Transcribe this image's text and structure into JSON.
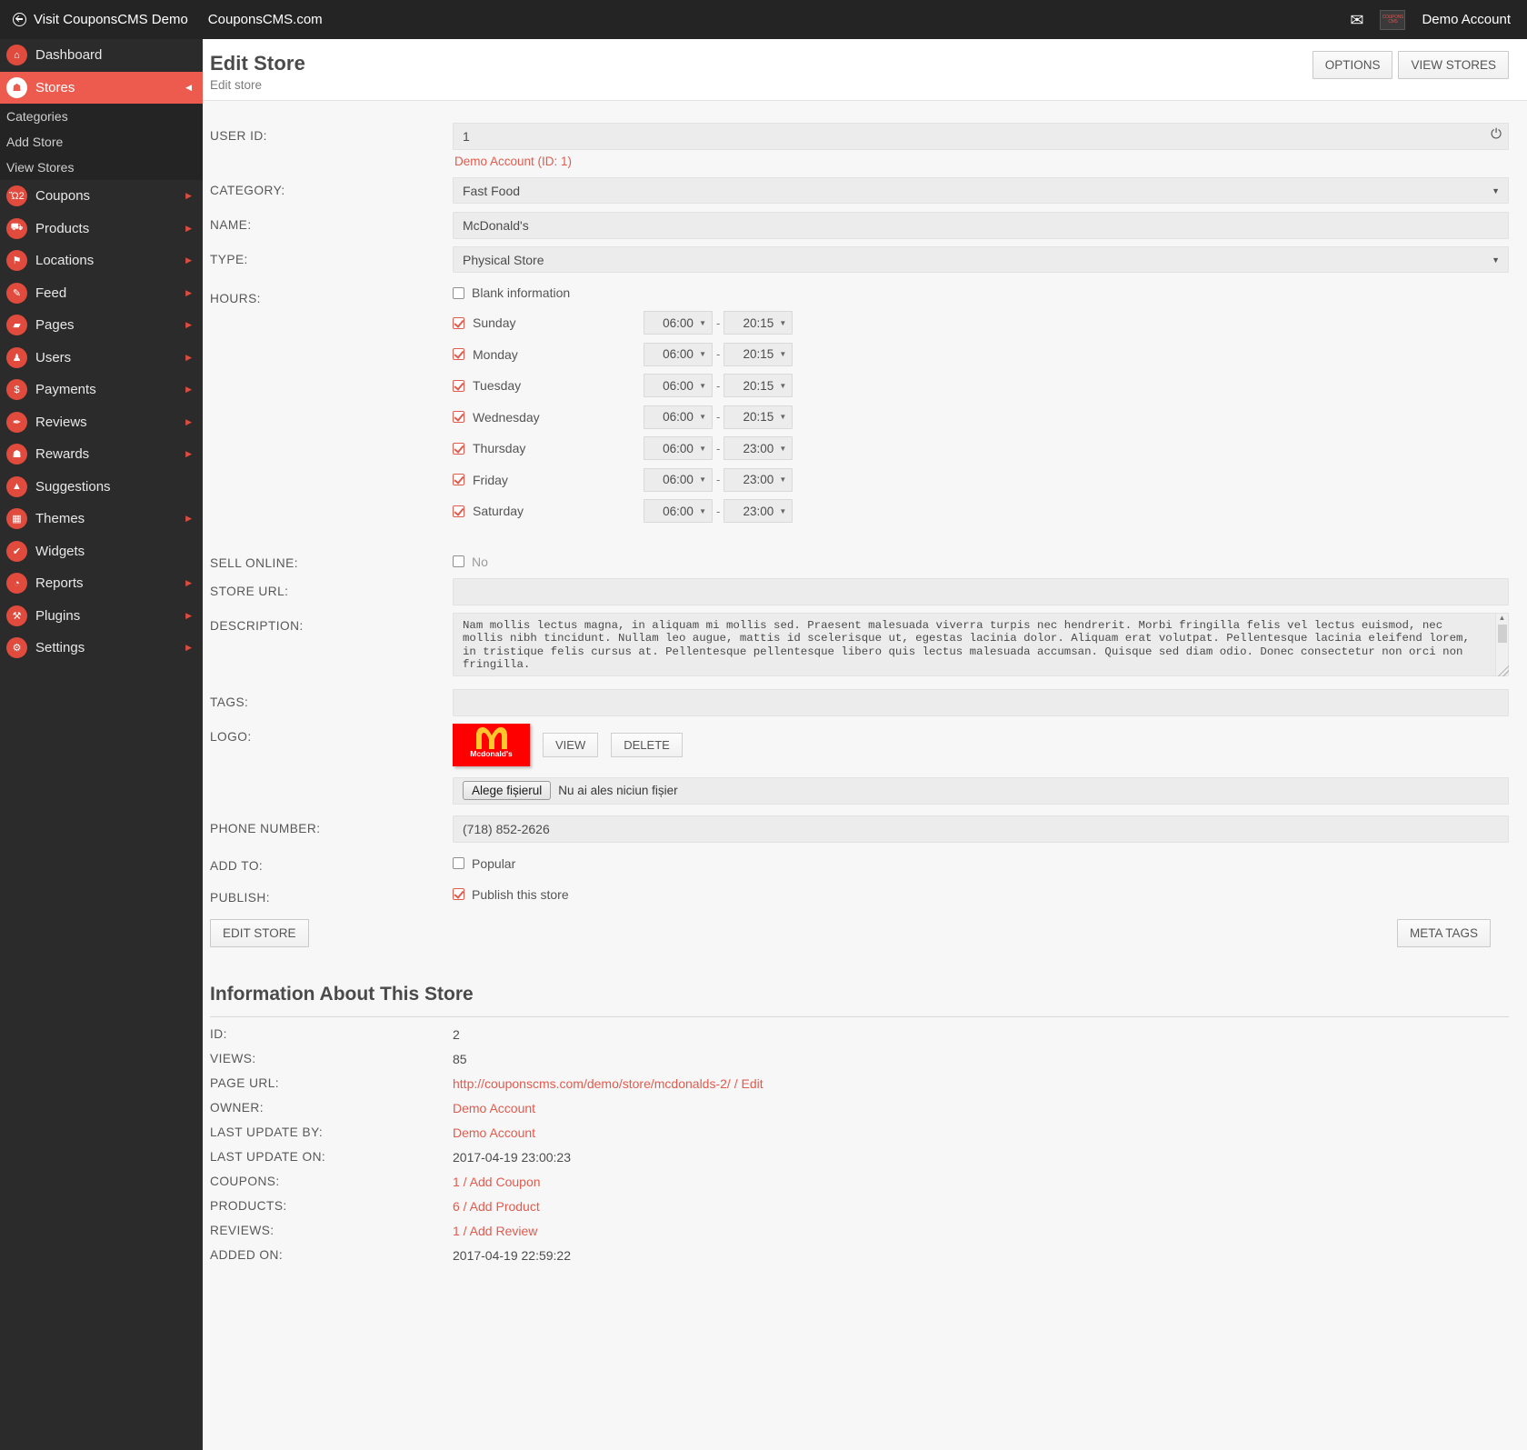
{
  "topbar": {
    "visit_demo": "Visit CouponsCMS Demo",
    "site_link": "CouponsCMS.com",
    "envelope_icon": "envelope-icon",
    "avatar_text": "COUPONS CMS",
    "account_name": "Demo Account"
  },
  "sidebar": {
    "items": [
      {
        "label": "Dashboard",
        "icon": "home-icon",
        "glyph": "⌂",
        "arrow": false,
        "active": false
      },
      {
        "label": "Stores",
        "icon": "store-icon",
        "glyph": "☗",
        "arrow": true,
        "active": true
      },
      {
        "label": "Coupons",
        "icon": "cart-icon",
        "glyph": "Ὥ2",
        "arrow": true,
        "active": false
      },
      {
        "label": "Products",
        "icon": "cart-icon",
        "glyph": "⛟",
        "arrow": true,
        "active": false
      },
      {
        "label": "Locations",
        "icon": "pin-icon",
        "glyph": "⚑",
        "arrow": true,
        "active": false
      },
      {
        "label": "Feed",
        "icon": "pencil-icon",
        "glyph": "✎",
        "arrow": true,
        "active": false
      },
      {
        "label": "Pages",
        "icon": "page-icon",
        "glyph": "▰",
        "arrow": true,
        "active": false
      },
      {
        "label": "Users",
        "icon": "users-icon",
        "glyph": "♟",
        "arrow": true,
        "active": false
      },
      {
        "label": "Payments",
        "icon": "dollar-icon",
        "glyph": "$",
        "arrow": true,
        "active": false
      },
      {
        "label": "Reviews",
        "icon": "pen-icon",
        "glyph": "✒",
        "arrow": true,
        "active": false
      },
      {
        "label": "Rewards",
        "icon": "gift-icon",
        "glyph": "☗",
        "arrow": true,
        "active": false
      },
      {
        "label": "Suggestions",
        "icon": "bell-icon",
        "glyph": "▲",
        "arrow": false,
        "active": false
      },
      {
        "label": "Themes",
        "icon": "grid-icon",
        "glyph": "▦",
        "arrow": true,
        "active": false
      },
      {
        "label": "Widgets",
        "icon": "check-icon",
        "glyph": "✔",
        "arrow": false,
        "active": false
      },
      {
        "label": "Reports",
        "icon": "piechart-icon",
        "glyph": "◔",
        "arrow": true,
        "active": false
      },
      {
        "label": "Plugins",
        "icon": "plug-icon",
        "glyph": "⚒",
        "arrow": true,
        "active": false
      },
      {
        "label": "Settings",
        "icon": "gear-icon",
        "glyph": "⚙",
        "arrow": true,
        "active": false
      }
    ],
    "stores_submenu": [
      "Categories",
      "Add Store",
      "View Stores"
    ]
  },
  "header": {
    "title": "Edit Store",
    "subtitle": "Edit store",
    "options_button": "OPTIONS",
    "view_stores_button": "VIEW STORES"
  },
  "form": {
    "user_id_label": "USER ID:",
    "user_id_value": "1",
    "user_id_helper": "Demo Account (ID: 1)",
    "category_label": "CATEGORY:",
    "category_value": "Fast Food",
    "name_label": "NAME:",
    "name_value": "McDonald's",
    "type_label": "TYPE:",
    "type_value": "Physical Store",
    "hours_label": "HOURS:",
    "blank_information": "Blank information",
    "blank_information_checked": false,
    "days": [
      {
        "name": "Sunday",
        "checked": true,
        "open": "06:00",
        "close": "20:15"
      },
      {
        "name": "Monday",
        "checked": true,
        "open": "06:00",
        "close": "20:15"
      },
      {
        "name": "Tuesday",
        "checked": true,
        "open": "06:00",
        "close": "20:15"
      },
      {
        "name": "Wednesday",
        "checked": true,
        "open": "06:00",
        "close": "20:15"
      },
      {
        "name": "Thursday",
        "checked": true,
        "open": "06:00",
        "close": "23:00"
      },
      {
        "name": "Friday",
        "checked": true,
        "open": "06:00",
        "close": "23:00"
      },
      {
        "name": "Saturday",
        "checked": true,
        "open": "06:00",
        "close": "23:00"
      }
    ],
    "sell_online_label": "SELL ONLINE:",
    "sell_online_value": "No",
    "sell_online_checked": false,
    "store_url_label": "STORE URL:",
    "store_url_value": "",
    "description_label": "DESCRIPTION:",
    "description_value": "Nam mollis lectus magna, in aliquam mi mollis sed. Praesent malesuada viverra turpis nec hendrerit. Morbi fringilla felis vel lectus euismod, nec mollis nibh tincidunt. Nullam leo augue, mattis id scelerisque ut, egestas lacinia dolor. Aliquam erat volutpat. Pellentesque lacinia eleifend lorem, in tristique felis cursus at. Pellentesque pellentesque libero quis lectus malesuada accumsan. Quisque sed diam odio. Donec consectetur non orci non fringilla.",
    "tags_label": "TAGS:",
    "tags_value": "",
    "logo_label": "LOGO:",
    "logo_alt": "Mcdonald's",
    "logo_view_button": "VIEW",
    "logo_delete_button": "DELETE",
    "file_choose_button": "Alege fișierul",
    "file_status": "Nu ai ales niciun fișier",
    "phone_label": "PHONE NUMBER:",
    "phone_value": "(718) 852-2626",
    "add_to_label": "ADD TO:",
    "add_to_value": "Popular",
    "add_to_checked": false,
    "publish_label": "PUBLISH:",
    "publish_value": "Publish this store",
    "publish_checked": true,
    "edit_store_button": "EDIT STORE",
    "meta_tags_button": "META TAGS"
  },
  "info": {
    "title": "Information About This Store",
    "rows": [
      {
        "label": "ID:",
        "value": "2",
        "link": false
      },
      {
        "label": "VIEWS:",
        "value": "85",
        "link": false
      },
      {
        "label": "PAGE URL:",
        "value": "http://couponscms.com/demo/store/mcdonalds-2/ / Edit",
        "link": true
      },
      {
        "label": "OWNER:",
        "value": "Demo Account",
        "link": true
      },
      {
        "label": "LAST UPDATE BY:",
        "value": "Demo Account",
        "link": true
      },
      {
        "label": "LAST UPDATE ON:",
        "value": "2017-04-19 23:00:23",
        "link": false
      },
      {
        "label": "COUPONS:",
        "value": "1 / Add Coupon",
        "link": true
      },
      {
        "label": "PRODUCTS:",
        "value": "6 / Add Product",
        "link": true
      },
      {
        "label": "REVIEWS:",
        "value": "1 / Add Review",
        "link": true
      },
      {
        "label": "ADDED ON:",
        "value": "2017-04-19 22:59:22",
        "link": false
      }
    ]
  },
  "colors": {
    "accent": "#e05b4e",
    "sidebar_bg": "#2b2b2b",
    "topbar_bg": "#242424",
    "active_nav": "#ec5b4e"
  }
}
